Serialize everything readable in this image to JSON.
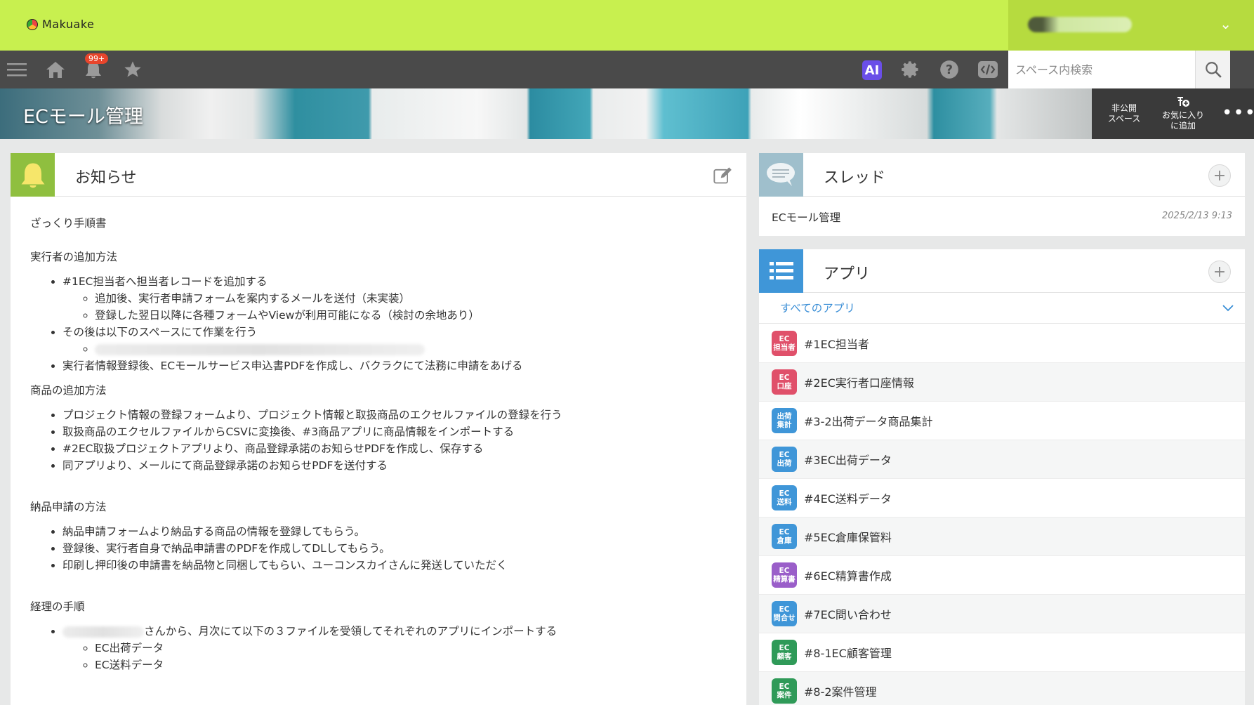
{
  "brand": {
    "name": "Makuake"
  },
  "user": {
    "chevron": "⌄"
  },
  "toolbar": {
    "notification_count": "99+",
    "ai_label": "AI"
  },
  "search": {
    "placeholder": "スペース内検索"
  },
  "space": {
    "title": "ECモール管理",
    "private_label_1": "非公開",
    "private_label_2": "スペース",
    "favorite_label_1": "お気に入り",
    "favorite_label_2": "に追加",
    "more": "•••"
  },
  "notice": {
    "title": "お知らせ",
    "sections": {
      "s1": "ざっくり手順書",
      "s2": "実行者の追加方法",
      "s2_i1": "#1EC担当者へ担当者レコードを追加する",
      "s2_i1_a": "追加後、実行者申請フォームを案内するメールを送付（未実装）",
      "s2_i1_b": "登録した翌日以降に各種フォームやViewが利用可能になる（検討の余地あり）",
      "s2_i2": "その後は以下のスペースにて作業を行う",
      "s2_i3": "実行者情報登録後、ECモールサービス申込書PDFを作成し、バクラクにて法務に申請をあげる",
      "s3": "商品の追加方法",
      "s3_i1": "プロジェクト情報の登録フォームより、プロジェクト情報と取扱商品のエクセルファイルの登録を行う",
      "s3_i2": "取扱商品のエクセルファイルからCSVに変換後、#3商品アプリに商品情報をインポートする",
      "s3_i3": "#2EC取扱プロジェクトアプリより、商品登録承諾のお知らせPDFを作成し、保存する",
      "s3_i4": "同アプリより、メールにて商品登録承諾のお知らせPDFを送付する",
      "s4": "納品申請の方法",
      "s4_i1": "納品申請フォームより納品する商品の情報を登録してもらう。",
      "s4_i2": "登録後、実行者自身で納品申請書のPDFを作成してDLしてもらう。",
      "s4_i3": "印刷し押印後の申請書を納品物と同梱してもらい、ユーコンスカイさんに発送していただく",
      "s5": "経理の手順",
      "s5_i1": "さんから、月次にて以下の３ファイルを受領してそれぞれのアプリにインポートする",
      "s5_i1_a": "EC出荷データ",
      "s5_i1_b": "EC送料データ"
    }
  },
  "thread": {
    "title": "スレッド",
    "items": [
      {
        "name": "ECモール管理",
        "date": "2025/2/13 9:13"
      }
    ]
  },
  "apps": {
    "title": "アプリ",
    "filter": "すべてのアプリ",
    "items": [
      {
        "label": "#1EC担当者",
        "badge_top": "EC",
        "badge_bottom": "担当者",
        "color": "#e0506a"
      },
      {
        "label": "#2EC実行者口座情報",
        "badge_top": "EC",
        "badge_bottom": "口座",
        "color": "#e0506a"
      },
      {
        "label": "#3-2出荷データ商品集計",
        "badge_top": "出荷",
        "badge_bottom": "集計",
        "color": "#3f96d8"
      },
      {
        "label": "#3EC出荷データ",
        "badge_top": "EC",
        "badge_bottom": "出荷",
        "color": "#3f96d8"
      },
      {
        "label": "#4EC送料データ",
        "badge_top": "EC",
        "badge_bottom": "送料",
        "color": "#3f96d8"
      },
      {
        "label": "#5EC倉庫保管料",
        "badge_top": "EC",
        "badge_bottom": "倉庫",
        "color": "#3f96d8"
      },
      {
        "label": "#6EC精算書作成",
        "badge_top": "EC",
        "badge_bottom": "精算書",
        "color": "#9a5ec9"
      },
      {
        "label": "#7EC問い合わせ",
        "badge_top": "EC",
        "badge_bottom": "問合せ",
        "color": "#3f96d8"
      },
      {
        "label": "#8-1EC顧客管理",
        "badge_top": "EC",
        "badge_bottom": "顧客",
        "color": "#2f9a58"
      },
      {
        "label": "#8-2案件管理",
        "badge_top": "EC",
        "badge_bottom": "案件",
        "color": "#2f9a58"
      }
    ]
  },
  "colors": {
    "brand_green": "#c8f04f",
    "toolbar": "#4a4a4a",
    "link_blue": "#3a8ed6",
    "bell_green": "#8fbf3f"
  }
}
